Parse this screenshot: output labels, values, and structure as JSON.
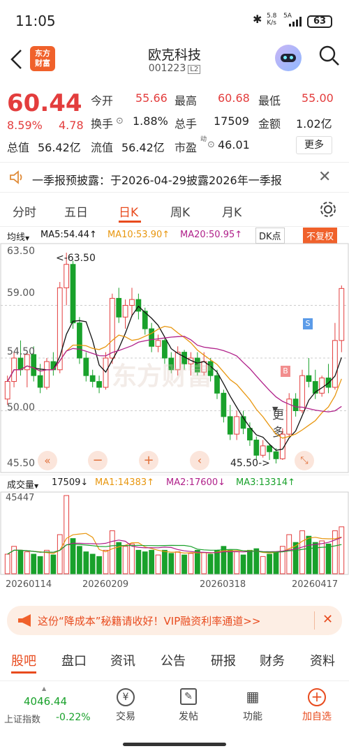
{
  "status": {
    "time": "11:05",
    "speed": "5.8",
    "speed_unit": "K/s",
    "net": "5A",
    "battery": "63"
  },
  "header": {
    "logo_line1": "东方",
    "logo_line2": "财富",
    "name": "欧克科技",
    "code": "001223",
    "level": "L2"
  },
  "quote": {
    "price": "60.44",
    "pct": "8.59%",
    "change": "4.78",
    "open_label": "今开",
    "open": "55.66",
    "high_label": "最高",
    "high": "60.68",
    "low_label": "最低",
    "low": "55.00",
    "turnover_label": "换手",
    "turnover": "1.88%",
    "volume_label": "总手",
    "volume": "17509",
    "amount_label": "金额",
    "amount": "1.02亿",
    "mcap_label": "总值",
    "mcap": "56.42亿",
    "float_label": "流值",
    "float": "56.42亿",
    "pe_label": "市盈",
    "pe_sup": "动",
    "pe": "46.01",
    "more": "更多"
  },
  "notice": {
    "text": "一季报预披露：于2026-04-29披露2026年一季报"
  },
  "tabs": [
    "分时",
    "五日",
    "日K",
    "周K",
    "月K",
    "更多"
  ],
  "indicator": {
    "selector": "均线",
    "ma5": "MA5:54.44↑",
    "ma10": "MA10:53.90↑",
    "ma20": "MA20:50.95↑",
    "dk": "DK点",
    "adjust": "不复权"
  },
  "price_axis": [
    "63.50",
    "59.00",
    "54.50",
    "50.00",
    "45.50"
  ],
  "annotations": {
    "high": "<-63.50",
    "low": "45.50->",
    "buy": "B",
    "sell": "S",
    "watermark": "东方财富"
  },
  "volume": {
    "selector": "成交量",
    "value": "17509↓",
    "ma1": "MA1:14383↑",
    "ma2": "MA2:17600↓",
    "ma3": "MA3:13314↑",
    "max": "45447"
  },
  "dates": [
    "20260114",
    "20260209",
    "20260318",
    "20260417"
  ],
  "banner": {
    "text": "这份“降成本”秘籍请收好！VIP融资利率通道>>"
  },
  "bottom_tabs": [
    "股吧",
    "盘口",
    "资讯",
    "公告",
    "研报",
    "财务",
    "资料"
  ],
  "index": {
    "value": "4046.44",
    "name": "上证指数",
    "change": "-0.22%"
  },
  "nav": [
    "交易",
    "发帖",
    "功能",
    "加自选"
  ],
  "colors": {
    "up": "#e33d3d",
    "down": "#19a12b",
    "ma5": "#111111",
    "ma10": "#e8960e",
    "ma20": "#b0208a",
    "accent": "#f0612b"
  },
  "chart_data": {
    "type": "candlestick",
    "y_range": [
      45.5,
      63.5
    ],
    "candles": [
      [
        51,
        53,
        50.5,
        52.5
      ],
      [
        52.5,
        55,
        52,
        54.5
      ],
      [
        54.5,
        56,
        53,
        53.5
      ],
      [
        53.5,
        55,
        52,
        54.8
      ],
      [
        54.8,
        55.5,
        52.5,
        53
      ],
      [
        53,
        54,
        51.5,
        52
      ],
      [
        52,
        54.5,
        51.8,
        54.2
      ],
      [
        54.2,
        55,
        53,
        53.5
      ],
      [
        53.5,
        61,
        53.2,
        60.5
      ],
      [
        60.5,
        63.5,
        59,
        62.5
      ],
      [
        62.5,
        62.8,
        57,
        57.5
      ],
      [
        57.5,
        58,
        54,
        54.5
      ],
      [
        54.5,
        55,
        52.5,
        53
      ],
      [
        53,
        53.5,
        52,
        52.5
      ],
      [
        52.5,
        53,
        51.5,
        52
      ],
      [
        52,
        55,
        51.8,
        54.5
      ],
      [
        54.5,
        60,
        54,
        59.6
      ],
      [
        59.6,
        60.5,
        57.5,
        58
      ],
      [
        58,
        59.5,
        57,
        59
      ],
      [
        59,
        60.5,
        58,
        59.5
      ],
      [
        59.5,
        60,
        57.8,
        58.5
      ],
      [
        58.5,
        58.8,
        56.5,
        57
      ],
      [
        57,
        57.5,
        55,
        55.5
      ],
      [
        55.5,
        56.5,
        55,
        56
      ],
      [
        56,
        56.2,
        54,
        54.5
      ],
      [
        54.5,
        55,
        53.2,
        53.5
      ],
      [
        53.5,
        55.5,
        53,
        55
      ],
      [
        55,
        55.2,
        53.5,
        54
      ],
      [
        54,
        55,
        53,
        54.5
      ],
      [
        54.5,
        55,
        53,
        53.3
      ],
      [
        53.3,
        55,
        53,
        54.2
      ],
      [
        54.2,
        54.5,
        52.5,
        53
      ],
      [
        53,
        53.5,
        51,
        51.5
      ],
      [
        51.5,
        51.8,
        49,
        49.5
      ],
      [
        49.5,
        50.5,
        47.5,
        48
      ],
      [
        48,
        50,
        47.5,
        49.5
      ],
      [
        49.5,
        50,
        48,
        48.5
      ],
      [
        48.5,
        49,
        47,
        47.5
      ],
      [
        47.5,
        47.8,
        45.8,
        46.2
      ],
      [
        46.2,
        47.5,
        46,
        47
      ],
      [
        47,
        47.2,
        45.8,
        46.5
      ],
      [
        46.5,
        46.8,
        45.5,
        45.9
      ],
      [
        45.9,
        48.5,
        45.8,
        48
      ],
      [
        48,
        51.5,
        47.8,
        51
      ],
      [
        51,
        51.5,
        49.5,
        50
      ],
      [
        50,
        53.5,
        49.8,
        53
      ],
      [
        53,
        54.5,
        52,
        52.5
      ],
      [
        52.5,
        53.5,
        51,
        51.5
      ],
      [
        51.5,
        53,
        51.2,
        52.8
      ],
      [
        52.8,
        54,
        51.5,
        52
      ],
      [
        52,
        57.5,
        51.8,
        56
      ],
      [
        56,
        60.7,
        55,
        60.44
      ]
    ],
    "volume_ratio": [
      0.25,
      0.35,
      0.3,
      0.28,
      0.25,
      0.22,
      0.3,
      0.24,
      0.5,
      1.0,
      0.45,
      0.35,
      0.28,
      0.25,
      0.22,
      0.3,
      0.55,
      0.4,
      0.35,
      0.38,
      0.3,
      0.28,
      0.3,
      0.24,
      0.3,
      0.26,
      0.28,
      0.24,
      0.26,
      0.3,
      0.27,
      0.25,
      0.3,
      0.35,
      0.3,
      0.28,
      0.24,
      0.3,
      0.32,
      0.22,
      0.25,
      0.28,
      0.35,
      0.5,
      0.4,
      0.55,
      0.48,
      0.4,
      0.42,
      0.38,
      0.55,
      0.6
    ]
  }
}
